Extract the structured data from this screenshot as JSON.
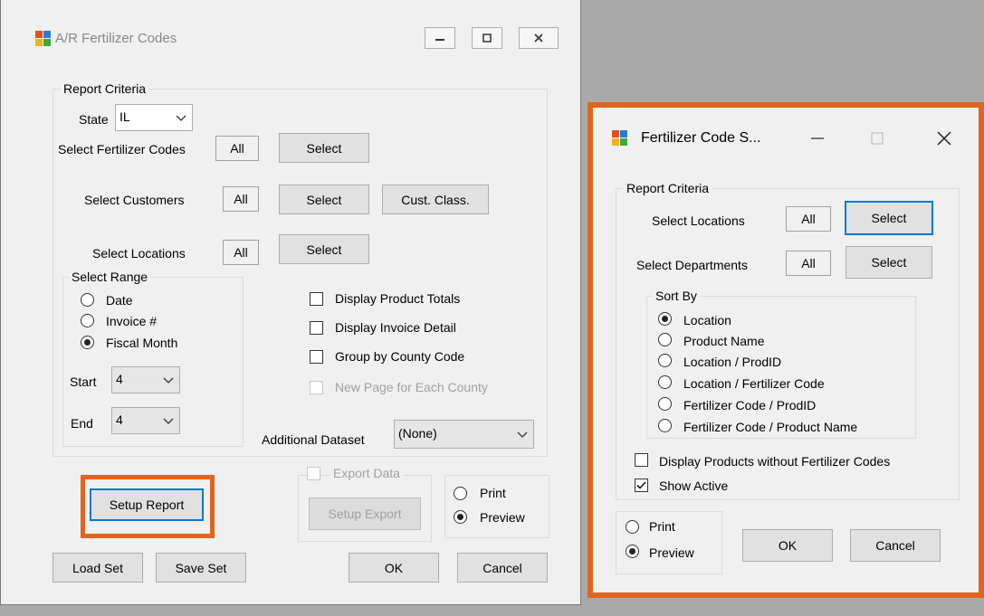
{
  "main": {
    "title": "A/R Fertilizer Codes",
    "icons": [
      "app-icon",
      "minimize-icon",
      "maximize-icon",
      "close-icon"
    ],
    "report_criteria_label": "Report Criteria",
    "state_label": "State",
    "state_value": "IL",
    "select_fert_codes_label": "Select Fertilizer Codes",
    "select_customers_label": "Select Customers",
    "select_locations_label": "Select Locations",
    "all_text": "All",
    "select_button": "Select",
    "cust_class_button": "Cust. Class.",
    "select_range_label": "Select Range",
    "range_options": [
      "Date",
      "Invoice #",
      "Fiscal Month"
    ],
    "range_selected": "Fiscal Month",
    "start_label": "Start",
    "start_value": "4",
    "end_label": "End",
    "end_value": "4",
    "checkboxes": [
      {
        "label": "Display Product Totals",
        "checked": false,
        "enabled": true
      },
      {
        "label": "Display Invoice Detail",
        "checked": false,
        "enabled": true
      },
      {
        "label": "Group by County Code",
        "checked": false,
        "enabled": true
      },
      {
        "label": "New Page for Each County",
        "checked": false,
        "enabled": false
      }
    ],
    "additional_dataset_label": "Additional Dataset",
    "additional_dataset_value": "(None)",
    "setup_report_button": "Setup Report",
    "export_data_label": "Export Data",
    "setup_export_button": "Setup Export",
    "print_label": "Print",
    "preview_label": "Preview",
    "output_selected": "Preview",
    "load_set_button": "Load Set",
    "save_set_button": "Save Set",
    "ok_button": "OK",
    "cancel_button": "Cancel"
  },
  "dialog": {
    "title": "Fertilizer Code S...",
    "icons": [
      "app-icon",
      "minimize-icon",
      "maximize-icon",
      "close-icon"
    ],
    "report_criteria_label": "Report Criteria",
    "select_locations_label": "Select Locations",
    "select_departments_label": "Select Departments",
    "all_text": "All",
    "select_button": "Select",
    "sort_by_label": "Sort By",
    "sort_options": [
      "Location",
      "Product Name",
      "Location / ProdID",
      "Location / Fertilizer Code",
      "Fertilizer Code / ProdID",
      "Fertilizer Code / Product Name"
    ],
    "sort_selected": "Location",
    "display_products_label": "Display Products without Fertilizer Codes",
    "display_products_checked": false,
    "show_active_label": "Show Active",
    "show_active_checked": true,
    "print_label": "Print",
    "preview_label": "Preview",
    "output_selected": "Preview",
    "ok_button": "OK",
    "cancel_button": "Cancel"
  },
  "colors": {
    "highlight_orange": "#e0651e",
    "focus_blue": "#0078d7",
    "background": "#a9a9a9",
    "window": "#f0f0f0"
  }
}
